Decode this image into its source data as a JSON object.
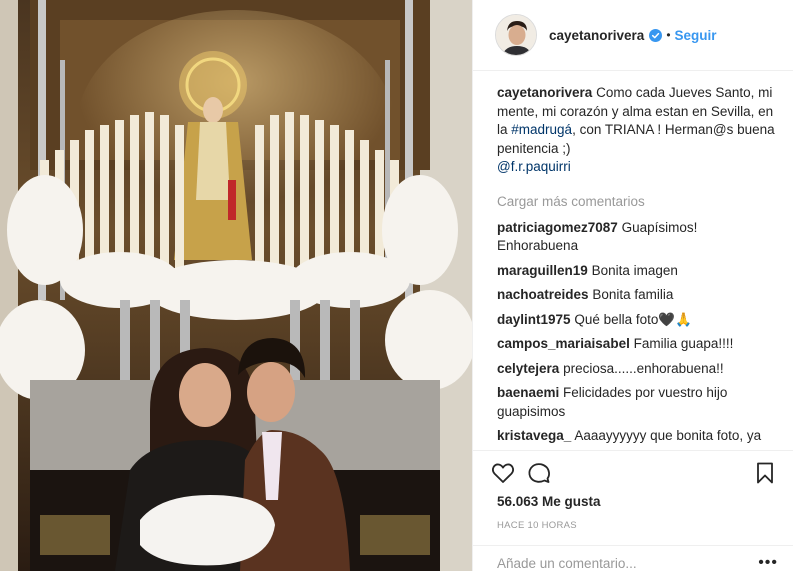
{
  "post": {
    "username": "cayetanorivera",
    "separator": "•",
    "follow_label": "Seguir",
    "verified_icon": "verified-badge-icon",
    "accent_color": "#3897f0"
  },
  "caption": {
    "username": "cayetanorivera",
    "text_1": "Como cada Jueves Santo, mi mente, mi corazón y alma estan en Sevilla, en la ",
    "hashtag": "#madrugá",
    "text_2": ", con TRIANA ! Herman@s buena penitencia ;) ",
    "mention": "@f.r.paquirri"
  },
  "load_more_label": "Cargar más comentarios",
  "comments": [
    {
      "user": "patriciagomez7087",
      "text": "Guapísimos! Enhorabuena"
    },
    {
      "user": "maraguillen19",
      "text": "Bonita imagen"
    },
    {
      "user": "nachoatreides",
      "text": "Bonita familia"
    },
    {
      "user": "daylint1975",
      "text": "Qué bella foto🖤🙏"
    },
    {
      "user": "campos_mariaisabel",
      "text": "Familia guapa!!!!"
    },
    {
      "user": "celytejera",
      "text": "preciosa......enhorabuena!!"
    },
    {
      "user": "baenaemi",
      "text": "Felicidades por vuestro hijo guapisimos"
    },
    {
      "user": "kristavega_",
      "text": "Aaaayyyyyy que bonita foto, ya mismo estás junto con Cayetano de tu"
    }
  ],
  "actions": {
    "like_icon": "heart-icon",
    "comment_icon": "comment-bubble-icon",
    "save_icon": "bookmark-icon"
  },
  "likes_label": "56.063 Me gusta",
  "timestamp": "HACE 10 HORAS",
  "add_comment": {
    "placeholder": "Añade un comentario...",
    "more_label": "•••"
  }
}
